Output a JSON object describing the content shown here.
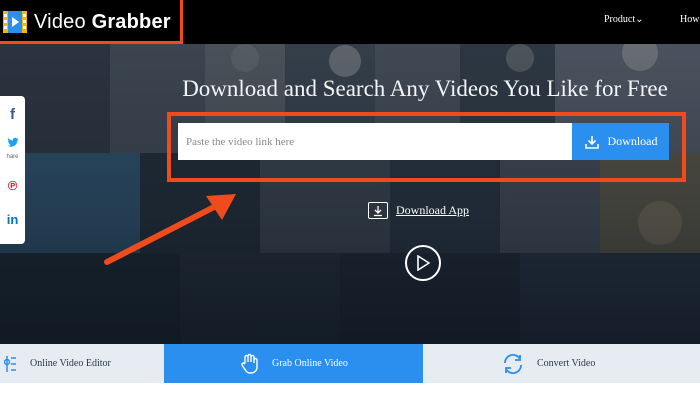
{
  "header": {
    "logo_text_light": "Video ",
    "logo_text_bold": "Grabber",
    "nav_product": "Product",
    "nav_how": "How"
  },
  "social": {
    "facebook": "f",
    "share_label": "hare",
    "linkedin": "in"
  },
  "hero": {
    "headline": "Download and Search Any Videos You Like for Free"
  },
  "search": {
    "placeholder": "Paste the video link here",
    "button_label": "Download"
  },
  "download_app": {
    "label": "Download App"
  },
  "tabs": [
    {
      "label": "Online Video Editor"
    },
    {
      "label": "Grab Online Video"
    },
    {
      "label": "Convert Video"
    }
  ],
  "colors": {
    "accent_blue": "#2b8ff0",
    "highlight_orange": "#f04b1d"
  }
}
